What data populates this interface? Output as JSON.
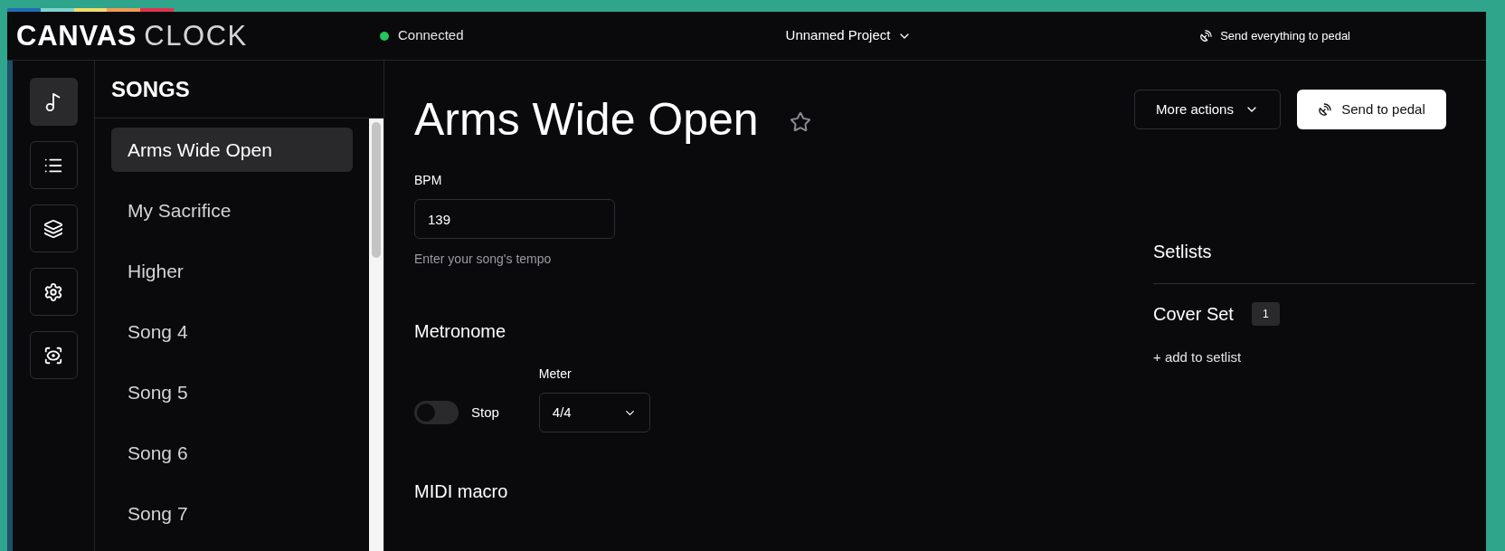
{
  "header": {
    "logo_bold": "CANVAS",
    "logo_light": "CLOCK",
    "status": {
      "label": "Connected",
      "color": "#22c55e"
    },
    "project": "Unnamed Project",
    "send_all": "Send everything to pedal"
  },
  "nav": [
    {
      "kind": "songs",
      "selected": true
    },
    {
      "kind": "list",
      "selected": false
    },
    {
      "kind": "layers",
      "selected": false
    },
    {
      "kind": "settings",
      "selected": false
    },
    {
      "kind": "preview",
      "selected": false
    }
  ],
  "songs_panel": {
    "title": "SONGS",
    "items": [
      {
        "label": "Arms Wide Open",
        "selected": true
      },
      {
        "label": "My Sacrifice",
        "selected": false
      },
      {
        "label": "Higher",
        "selected": false
      },
      {
        "label": "Song 4",
        "selected": false
      },
      {
        "label": "Song 5",
        "selected": false
      },
      {
        "label": "Song 6",
        "selected": false
      },
      {
        "label": "Song 7",
        "selected": false
      }
    ]
  },
  "song": {
    "title": "Arms Wide Open",
    "starred": false,
    "more_actions": "More actions",
    "send": "Send to pedal",
    "bpm": {
      "label": "BPM",
      "value": "139",
      "hint": "Enter your song's tempo"
    },
    "metronome": {
      "heading": "Metronome",
      "on": false,
      "toggle_label": "Stop",
      "meter_label": "Meter",
      "meter": "4/4"
    },
    "midi_heading": "MIDI macro"
  },
  "setlists": {
    "heading": "Setlists",
    "items": [
      {
        "name": "Cover Set",
        "count": "1"
      }
    ],
    "add": "+ add to setlist"
  }
}
